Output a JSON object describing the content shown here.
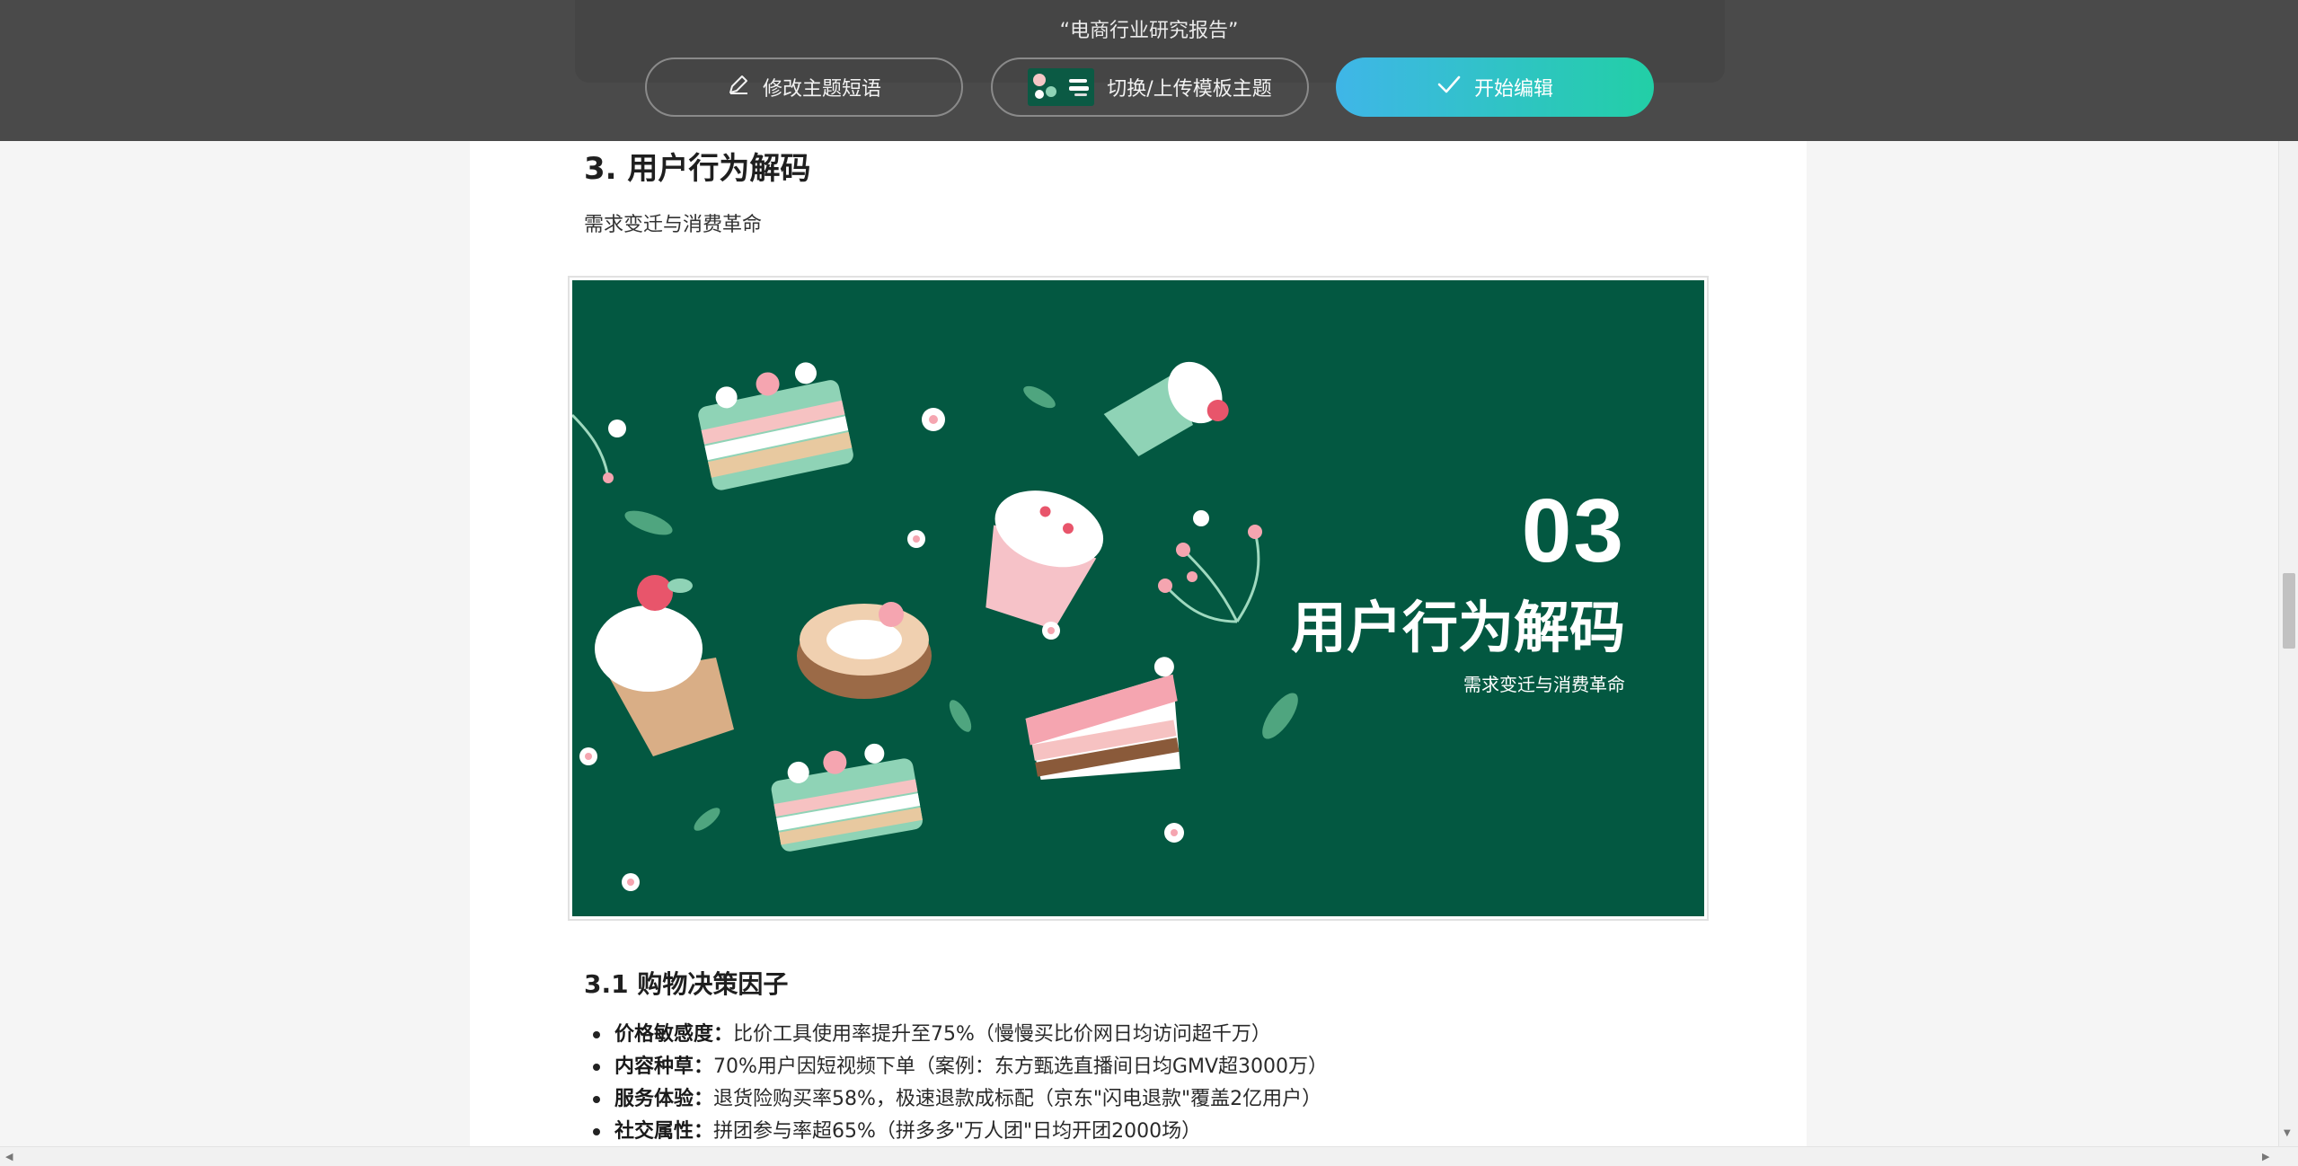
{
  "toolbar": {
    "doc_title": "“电商行业研究报告”",
    "edit_theme_label": "修改主题短语",
    "switch_template_label": "切换/上传模板主题",
    "start_edit_label": "开始编辑"
  },
  "section": {
    "heading": "3. 用户行为解码",
    "subtitle": "需求变迁与消费革命"
  },
  "slide": {
    "number": "03",
    "title": "用户行为解码",
    "subtitle": "需求变迁与消费革命",
    "background_color": "#035841"
  },
  "subsection": {
    "heading": "3.1 购物决策因子",
    "bullets": [
      {
        "label": "价格敏感度：",
        "text": "比价工具使用率提升至75%（慢慢买比价网日均访问超千万）"
      },
      {
        "label": "内容种草：",
        "text": "70%用户因短视频下单（案例：东方甄选直播间日均GMV超3000万）"
      },
      {
        "label": "服务体验：",
        "text": "退货险购买率58%，极速退款成标配（京东\"闪电退款\"覆盖2亿用户）"
      },
      {
        "label": "社交属性：",
        "text": "拼团参与率超65%（拼多多\"万人团\"日均开团2000场）"
      }
    ]
  },
  "colors": {
    "toolbar_bg": "#4a4a4a",
    "accent_gradient_start": "#3fb6e8",
    "accent_gradient_end": "#22cfa6"
  },
  "icons": [
    "pencil-icon",
    "template-thumbnail",
    "check-icon"
  ]
}
